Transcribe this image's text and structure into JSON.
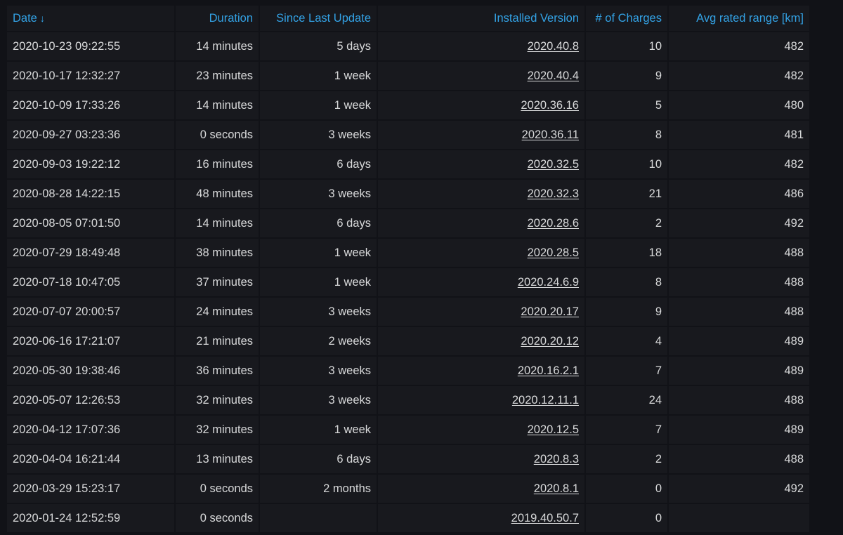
{
  "table": {
    "columns": [
      {
        "key": "date",
        "label": "Date",
        "sorted": "desc"
      },
      {
        "key": "duration",
        "label": "Duration"
      },
      {
        "key": "since",
        "label": "Since Last Update"
      },
      {
        "key": "version",
        "label": "Installed Version"
      },
      {
        "key": "charges",
        "label": "# of Charges"
      },
      {
        "key": "range",
        "label": "Avg rated range [km]"
      }
    ],
    "sort_icon": "arrow-down-icon",
    "sort_glyph": "↓",
    "rows": [
      {
        "date": "2020-10-23 09:22:55",
        "duration": "14 minutes",
        "since": "5 days",
        "version": "2020.40.8",
        "charges": "10",
        "range": "482"
      },
      {
        "date": "2020-10-17 12:32:27",
        "duration": "23 minutes",
        "since": "1 week",
        "version": "2020.40.4",
        "charges": "9",
        "range": "482"
      },
      {
        "date": "2020-10-09 17:33:26",
        "duration": "14 minutes",
        "since": "1 week",
        "version": "2020.36.16",
        "charges": "5",
        "range": "480"
      },
      {
        "date": "2020-09-27 03:23:36",
        "duration": "0 seconds",
        "since": "3 weeks",
        "version": "2020.36.11",
        "charges": "8",
        "range": "481"
      },
      {
        "date": "2020-09-03 19:22:12",
        "duration": "16 minutes",
        "since": "6 days",
        "version": "2020.32.5",
        "charges": "10",
        "range": "482"
      },
      {
        "date": "2020-08-28 14:22:15",
        "duration": "48 minutes",
        "since": "3 weeks",
        "version": "2020.32.3",
        "charges": "21",
        "range": "486"
      },
      {
        "date": "2020-08-05 07:01:50",
        "duration": "14 minutes",
        "since": "6 days",
        "version": "2020.28.6",
        "charges": "2",
        "range": "492"
      },
      {
        "date": "2020-07-29 18:49:48",
        "duration": "38 minutes",
        "since": "1 week",
        "version": "2020.28.5",
        "charges": "18",
        "range": "488"
      },
      {
        "date": "2020-07-18 10:47:05",
        "duration": "37 minutes",
        "since": "1 week",
        "version": "2020.24.6.9",
        "charges": "8",
        "range": "488"
      },
      {
        "date": "2020-07-07 20:00:57",
        "duration": "24 minutes",
        "since": "3 weeks",
        "version": "2020.20.17",
        "charges": "9",
        "range": "488"
      },
      {
        "date": "2020-06-16 17:21:07",
        "duration": "21 minutes",
        "since": "2 weeks",
        "version": "2020.20.12",
        "charges": "4",
        "range": "489"
      },
      {
        "date": "2020-05-30 19:38:46",
        "duration": "36 minutes",
        "since": "3 weeks",
        "version": "2020.16.2.1",
        "charges": "7",
        "range": "489"
      },
      {
        "date": "2020-05-07 12:26:53",
        "duration": "32 minutes",
        "since": "3 weeks",
        "version": "2020.12.11.1",
        "charges": "24",
        "range": "488"
      },
      {
        "date": "2020-04-12 17:07:36",
        "duration": "32 minutes",
        "since": "1 week",
        "version": "2020.12.5",
        "charges": "7",
        "range": "489"
      },
      {
        "date": "2020-04-04 16:21:44",
        "duration": "13 minutes",
        "since": "6 days",
        "version": "2020.8.3",
        "charges": "2",
        "range": "488"
      },
      {
        "date": "2020-03-29 15:23:17",
        "duration": "0 seconds",
        "since": "2 months",
        "version": "2020.8.1",
        "charges": "0",
        "range": "492"
      },
      {
        "date": "2020-01-24 12:52:59",
        "duration": "0 seconds",
        "since": "",
        "version": "2019.40.50.7",
        "charges": "0",
        "range": ""
      }
    ]
  },
  "colors": {
    "background": "#111217",
    "header_bg": "#17181d",
    "row_bg": "#18191e",
    "header_text": "#33a2e5",
    "cell_text": "#d8d9da"
  }
}
